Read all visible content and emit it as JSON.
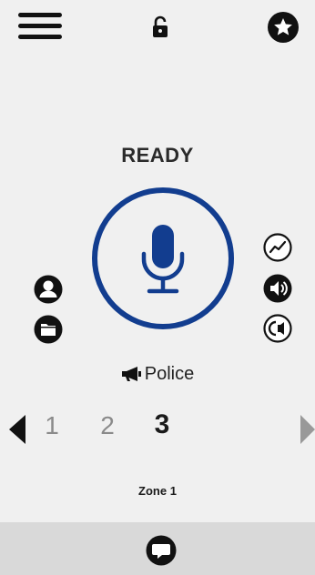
{
  "header": {
    "menu_icon": "hamburger-menu-icon",
    "lock_icon": "unlocked-padlock-icon",
    "favorite_icon": "star-circle-icon"
  },
  "status": {
    "text": "READY"
  },
  "ptt": {
    "icon": "microphone-icon",
    "accent": "#123d8f"
  },
  "left_actions": [
    {
      "icon": "contact-person-icon"
    },
    {
      "icon": "folder-icon"
    }
  ],
  "right_actions": [
    {
      "icon": "activity-line-icon"
    },
    {
      "icon": "speaker-volume-icon"
    },
    {
      "icon": "intercom-speaker-icon"
    }
  ],
  "channel": {
    "icon": "megaphone-icon",
    "name": "Police"
  },
  "pager": {
    "pages": [
      "1",
      "2",
      "3"
    ],
    "active": "3"
  },
  "zone": {
    "label": "Zone 1"
  },
  "bottom_bar": {
    "icon": "chat-bubble-icon"
  }
}
